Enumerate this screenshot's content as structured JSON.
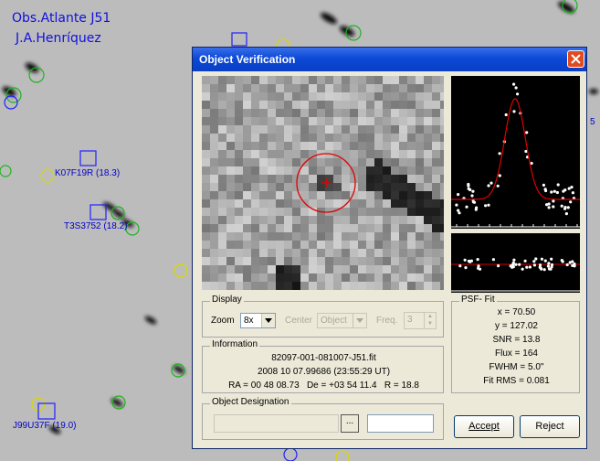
{
  "background": {
    "watermark_line1": "Obs.Atlante J51",
    "watermark_line2": "J.A.Henríquez",
    "labels": [
      "K07F19R (18.3)",
      "T3S3752 (18.2)",
      "J99U37F (19.0)"
    ],
    "edge_label": "5"
  },
  "dialog": {
    "title": "Object Verification",
    "display": {
      "group_label": "Display",
      "zoom_label": "Zoom",
      "zoom_value": "8x",
      "center_label": "Center",
      "center_value": "Object",
      "freq_label": "Freq.",
      "freq_value": "3"
    },
    "information": {
      "group_label": "Information",
      "filename": "82097-001-081007-J51.fit",
      "datetime": "2008 10 07.99686 (23:55:29 UT)",
      "coords": "RA = 00 48 08.73   De = +03 54 11.4   R = 18.8"
    },
    "designation": {
      "group_label": "Object Designation",
      "browse_label": "..."
    },
    "psf": {
      "group_label": "PSF- Fit",
      "x": "x = 70.50",
      "y": "y = 127.02",
      "snr": "SNR = 13.8",
      "flux": "Flux = 164",
      "fwhm": "FWHM = 5.0\"",
      "fitrms": "Fit RMS = 0.081"
    },
    "buttons": {
      "accept": "Accept",
      "reject": "Reject"
    }
  },
  "colors": {
    "titlebar": "#0b49d6",
    "fit_curve": "#e00000",
    "marker": "#e00000"
  }
}
